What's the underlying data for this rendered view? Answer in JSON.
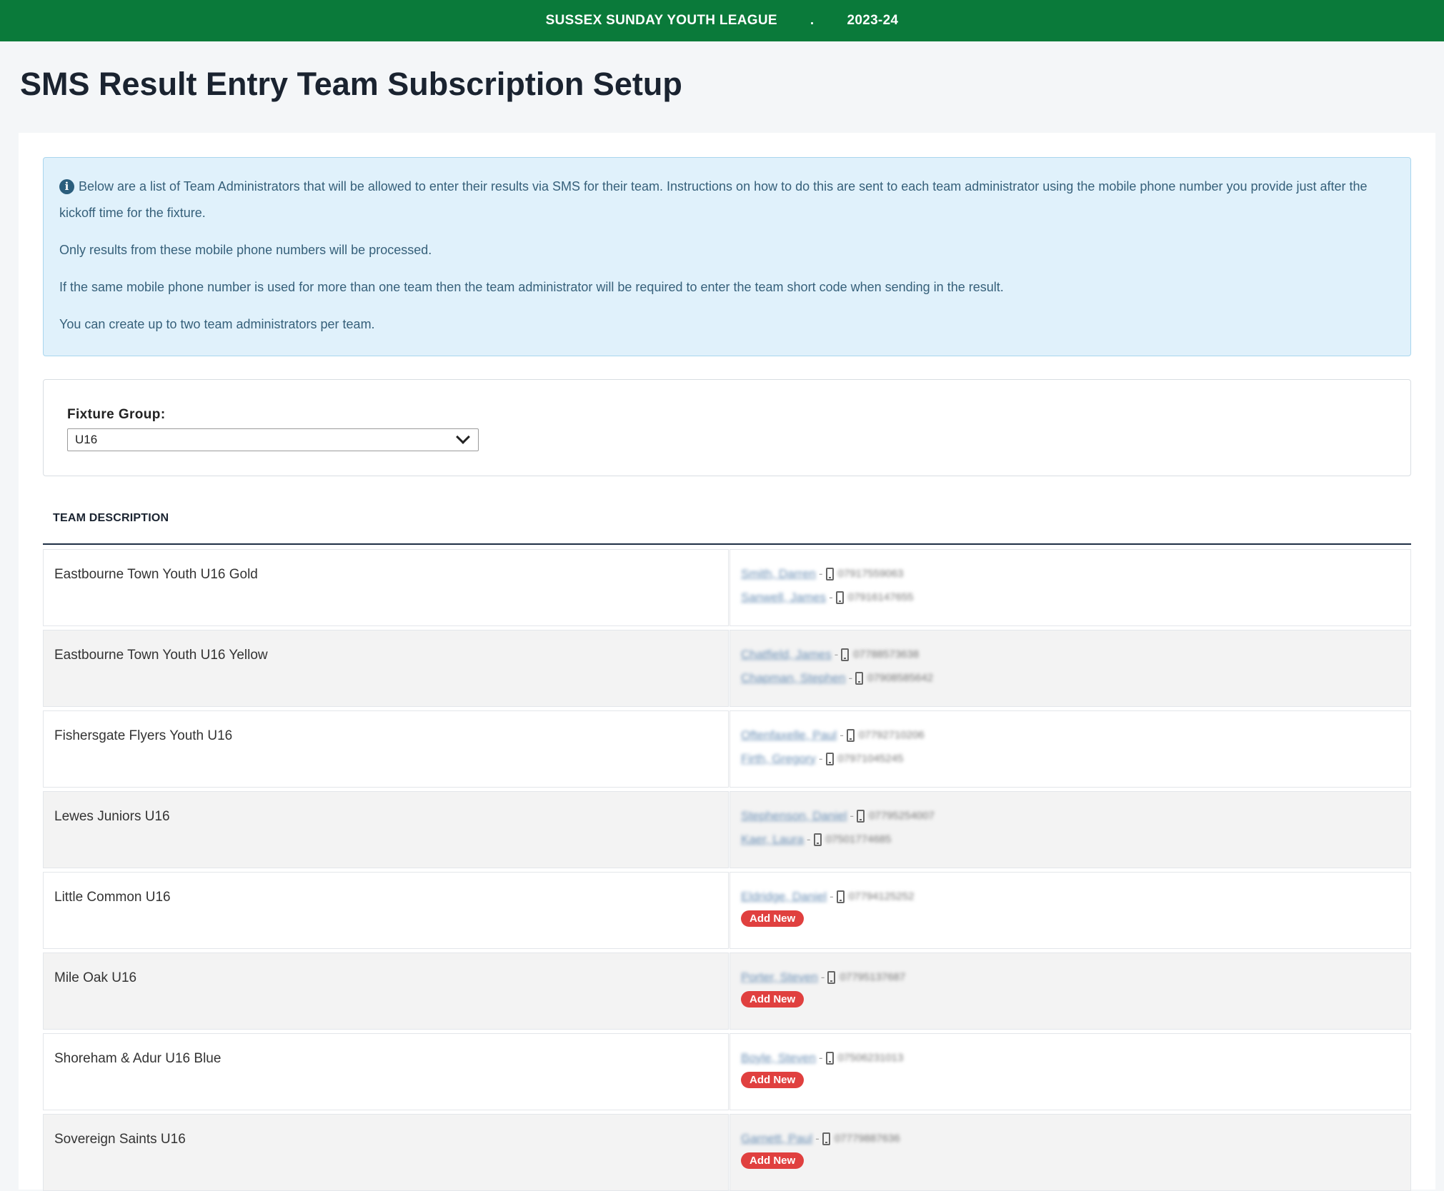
{
  "header": {
    "league": "SUSSEX SUNDAY YOUTH LEAGUE",
    "separator": ".",
    "season": "2023-24"
  },
  "page_title": "SMS Result Entry Team Subscription Setup",
  "info": {
    "p1": "Below are a list of Team Administrators that will be allowed to enter their results via SMS for their team. Instructions on how to do this are sent to each team administrator using the mobile phone number you provide just after the kickoff time for the fixture.",
    "p2": "Only results from these mobile phone numbers will be processed.",
    "p3": "If the same mobile phone number is used for more than one team then the team administrator will be required to enter the team short code when sending in the result.",
    "p4": "You can create up to two team administrators per team."
  },
  "filter": {
    "label": "Fixture Group:",
    "selected": "U16"
  },
  "table": {
    "header": "TEAM DESCRIPTION",
    "add_new_label": "Add New",
    "rows": [
      {
        "team": "Eastbourne Town Youth U16 Gold",
        "admins": [
          {
            "name": "Smith, Darren",
            "phone": "07917559063"
          },
          {
            "name": "Sanwell, James",
            "phone": "07916147655"
          }
        ]
      },
      {
        "team": "Eastbourne Town Youth U16 Yellow",
        "admins": [
          {
            "name": "Chatfield, James",
            "phone": "07788573638"
          },
          {
            "name": "Chapman, Stephen",
            "phone": "07908585642"
          }
        ]
      },
      {
        "team": "Fishersgate Flyers Youth U16",
        "admins": [
          {
            "name": "Oftenfaxelle, Paul",
            "phone": "07792710206"
          },
          {
            "name": "Firth, Gregory",
            "phone": "07971045245"
          }
        ]
      },
      {
        "team": "Lewes Juniors U16",
        "admins": [
          {
            "name": "Stephenson, Daniel",
            "phone": "07795254007"
          },
          {
            "name": "Kaer, Laura",
            "phone": "07501774685"
          }
        ]
      },
      {
        "team": "Little Common U16",
        "admins": [
          {
            "name": "Eldridge, Daniel",
            "phone": "07794125252"
          }
        ]
      },
      {
        "team": "Mile Oak U16",
        "admins": [
          {
            "name": "Porter, Steven",
            "phone": "07795137687"
          }
        ]
      },
      {
        "team": "Shoreham & Adur U16 Blue",
        "admins": [
          {
            "name": "Boyle, Steven",
            "phone": "07506231013"
          }
        ]
      },
      {
        "team": "Sovereign Saints U16",
        "admins": [
          {
            "name": "Garnett, Paul",
            "phone": "07779887636"
          }
        ]
      }
    ]
  }
}
